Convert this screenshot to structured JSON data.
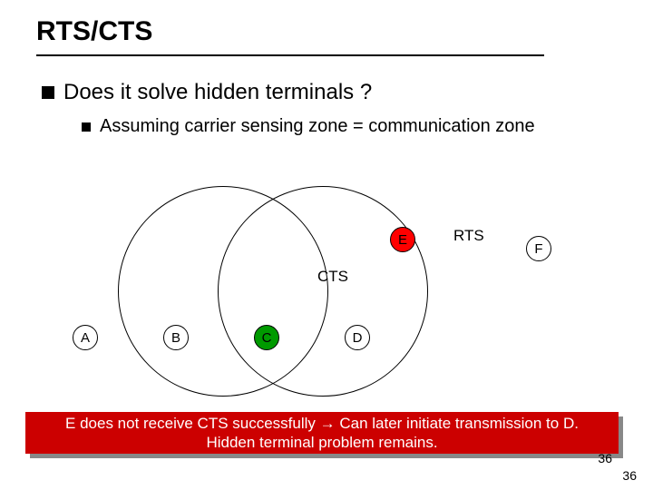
{
  "title": "RTS/CTS",
  "bullets": {
    "main": "Does it solve hidden terminals ?",
    "sub": "Assuming carrier sensing zone = communication zone"
  },
  "nodes": {
    "A": "A",
    "B": "B",
    "C": "C",
    "D": "D",
    "E": "E",
    "F": "F"
  },
  "labels": {
    "rts": "RTS",
    "cts": "CTS"
  },
  "footer": {
    "line1": "E does not receive CTS successfully → Can later initiate transmission to D.",
    "line2": "Hidden terminal problem remains."
  },
  "page": {
    "a": "36",
    "b": "36"
  }
}
